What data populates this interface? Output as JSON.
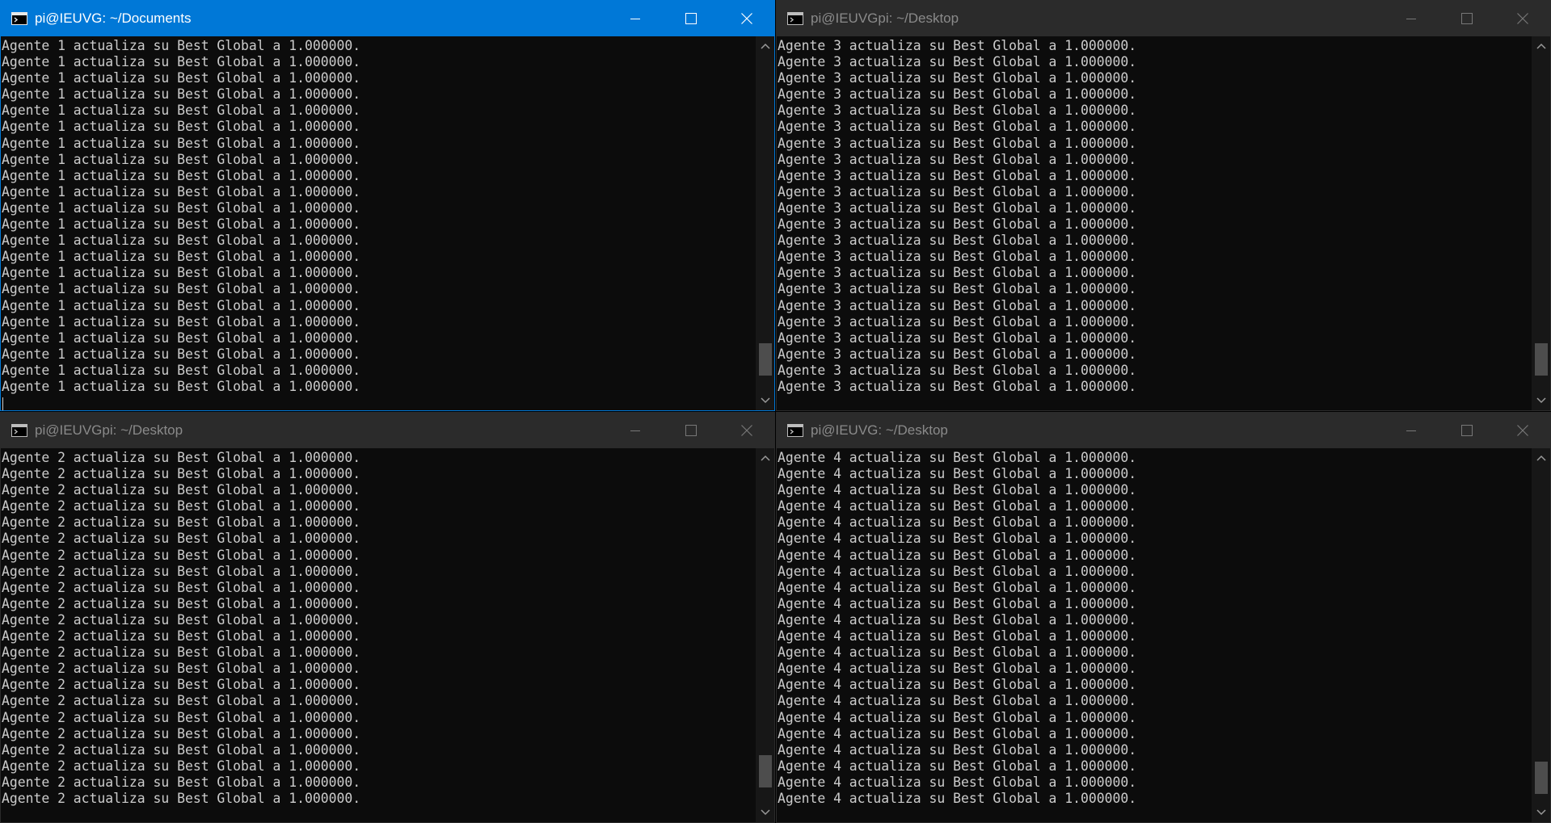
{
  "colors": {
    "active_titlebar": "#0078d7",
    "inactive_titlebar": "#2b2b2b",
    "console_bg": "#0c0c0c",
    "console_text": "#cccccc"
  },
  "windows": {
    "top_left": {
      "title": "pi@IEUVG: ~/Documents",
      "active": true,
      "scroll_position": 0.95,
      "lines": [
        "Agente 1 actualiza su Best Global a 1.000000.",
        "Agente 1 actualiza su Best Global a 1.000000.",
        "Agente 1 actualiza su Best Global a 1.000000.",
        "Agente 1 actualiza su Best Global a 1.000000.",
        "Agente 1 actualiza su Best Global a 1.000000.",
        "Agente 1 actualiza su Best Global a 1.000000.",
        "Agente 1 actualiza su Best Global a 1.000000.",
        "Agente 1 actualiza su Best Global a 1.000000.",
        "Agente 1 actualiza su Best Global a 1.000000.",
        "Agente 1 actualiza su Best Global a 1.000000.",
        "Agente 1 actualiza su Best Global a 1.000000.",
        "Agente 1 actualiza su Best Global a 1.000000.",
        "Agente 1 actualiza su Best Global a 1.000000.",
        "Agente 1 actualiza su Best Global a 1.000000.",
        "Agente 1 actualiza su Best Global a 1.000000.",
        "Agente 1 actualiza su Best Global a 1.000000.",
        "Agente 1 actualiza su Best Global a 1.000000.",
        "Agente 1 actualiza su Best Global a 1.000000.",
        "Agente 1 actualiza su Best Global a 1.000000.",
        "Agente 1 actualiza su Best Global a 1.000000.",
        "Agente 1 actualiza su Best Global a 1.000000.",
        "Agente 1 actualiza su Best Global a 1.000000."
      ]
    },
    "top_right": {
      "title": "pi@IEUVGpi: ~/Desktop",
      "active": false,
      "scroll_position": 0.95,
      "lines": [
        "Agente 3 actualiza su Best Global a 1.000000.",
        "Agente 3 actualiza su Best Global a 1.000000.",
        "Agente 3 actualiza su Best Global a 1.000000.",
        "Agente 3 actualiza su Best Global a 1.000000.",
        "Agente 3 actualiza su Best Global a 1.000000.",
        "Agente 3 actualiza su Best Global a 1.000000.",
        "Agente 3 actualiza su Best Global a 1.000000.",
        "Agente 3 actualiza su Best Global a 1.000000.",
        "Agente 3 actualiza su Best Global a 1.000000.",
        "Agente 3 actualiza su Best Global a 1.000000.",
        "Agente 3 actualiza su Best Global a 1.000000.",
        "Agente 3 actualiza su Best Global a 1.000000.",
        "Agente 3 actualiza su Best Global a 1.000000.",
        "Agente 3 actualiza su Best Global a 1.000000.",
        "Agente 3 actualiza su Best Global a 1.000000.",
        "Agente 3 actualiza su Best Global a 1.000000.",
        "Agente 3 actualiza su Best Global a 1.000000.",
        "Agente 3 actualiza su Best Global a 1.000000.",
        "Agente 3 actualiza su Best Global a 1.000000.",
        "Agente 3 actualiza su Best Global a 1.000000.",
        "Agente 3 actualiza su Best Global a 1.000000.",
        "Agente 3 actualiza su Best Global a 1.000000."
      ]
    },
    "bottom_left": {
      "title": "pi@IEUVGpi: ~/Desktop",
      "active": false,
      "scroll_position": 0.95,
      "lines": [
        "Agente 2 actualiza su Best Global a 1.000000.",
        "Agente 2 actualiza su Best Global a 1.000000.",
        "Agente 2 actualiza su Best Global a 1.000000.",
        "Agente 2 actualiza su Best Global a 1.000000.",
        "Agente 2 actualiza su Best Global a 1.000000.",
        "Agente 2 actualiza su Best Global a 1.000000.",
        "Agente 2 actualiza su Best Global a 1.000000.",
        "Agente 2 actualiza su Best Global a 1.000000.",
        "Agente 2 actualiza su Best Global a 1.000000.",
        "Agente 2 actualiza su Best Global a 1.000000.",
        "Agente 2 actualiza su Best Global a 1.000000.",
        "Agente 2 actualiza su Best Global a 1.000000.",
        "Agente 2 actualiza su Best Global a 1.000000.",
        "Agente 2 actualiza su Best Global a 1.000000.",
        "Agente 2 actualiza su Best Global a 1.000000.",
        "Agente 2 actualiza su Best Global a 1.000000.",
        "Agente 2 actualiza su Best Global a 1.000000.",
        "Agente 2 actualiza su Best Global a 1.000000.",
        "Agente 2 actualiza su Best Global a 1.000000.",
        "Agente 2 actualiza su Best Global a 1.000000.",
        "Agente 2 actualiza su Best Global a 1.000000.",
        "Agente 2 actualiza su Best Global a 1.000000."
      ]
    },
    "bottom_right": {
      "title": "pi@IEUVG: ~/Desktop",
      "active": false,
      "scroll_position": 0.97,
      "lines": [
        "Agente 4 actualiza su Best Global a 1.000000.",
        "Agente 4 actualiza su Best Global a 1.000000.",
        "Agente 4 actualiza su Best Global a 1.000000.",
        "Agente 4 actualiza su Best Global a 1.000000.",
        "Agente 4 actualiza su Best Global a 1.000000.",
        "Agente 4 actualiza su Best Global a 1.000000.",
        "Agente 4 actualiza su Best Global a 1.000000.",
        "Agente 4 actualiza su Best Global a 1.000000.",
        "Agente 4 actualiza su Best Global a 1.000000.",
        "Agente 4 actualiza su Best Global a 1.000000.",
        "Agente 4 actualiza su Best Global a 1.000000.",
        "Agente 4 actualiza su Best Global a 1.000000.",
        "Agente 4 actualiza su Best Global a 1.000000.",
        "Agente 4 actualiza su Best Global a 1.000000.",
        "Agente 4 actualiza su Best Global a 1.000000.",
        "Agente 4 actualiza su Best Global a 1.000000.",
        "Agente 4 actualiza su Best Global a 1.000000.",
        "Agente 4 actualiza su Best Global a 1.000000.",
        "Agente 4 actualiza su Best Global a 1.000000.",
        "Agente 4 actualiza su Best Global a 1.000000.",
        "Agente 4 actualiza su Best Global a 1.000000.",
        "Agente 4 actualiza su Best Global a 1.000000."
      ]
    }
  }
}
